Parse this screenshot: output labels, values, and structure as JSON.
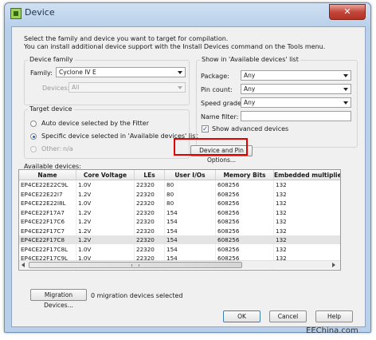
{
  "window": {
    "title": "Device",
    "close_symbol": "✕"
  },
  "intro": {
    "line1": "Select the family and device you want to target for compilation.",
    "line2": "You can install additional device support with the Install Devices command on the Tools menu."
  },
  "device_family": {
    "group_label": "Device family",
    "family_label": "Family:",
    "family_value": "Cyclone IV E",
    "devices_label": "Devices:",
    "devices_value": "All"
  },
  "target_device": {
    "group_label": "Target device",
    "option_auto": "Auto device selected by the Fitter",
    "option_specific": "Specific device selected in 'Available devices' list",
    "option_other": "Other:",
    "other_value": "n/a",
    "selected": "specific"
  },
  "show_in_list": {
    "group_label": "Show in 'Available devices' list",
    "package_label": "Package:",
    "package_value": "Any",
    "pin_count_label": "Pin count:",
    "pin_count_value": "Any",
    "speed_grade_label": "Speed grade:",
    "speed_grade_value": "Any",
    "name_filter_label": "Name filter:",
    "name_filter_value": "",
    "show_advanced_label": "Show advanced devices",
    "show_advanced_checked": true
  },
  "device_pin_options_label": "Device and Pin Options...",
  "available_devices": {
    "label": "Available devices:",
    "columns": [
      "Name",
      "Core Voltage",
      "LEs",
      "User I/Os",
      "Memory Bits",
      "Embedded multiplie"
    ],
    "rows": [
      [
        "EP4CE22E22C9L",
        "1.0V",
        "22320",
        "80",
        "608256",
        "132"
      ],
      [
        "EP4CE22E22I7",
        "1.2V",
        "22320",
        "80",
        "608256",
        "132"
      ],
      [
        "EP4CE22E22I8L",
        "1.0V",
        "22320",
        "80",
        "608256",
        "132"
      ],
      [
        "EP4CE22F17A7",
        "1.2V",
        "22320",
        "154",
        "608256",
        "132"
      ],
      [
        "EP4CE22F17C6",
        "1.2V",
        "22320",
        "154",
        "608256",
        "132"
      ],
      [
        "EP4CE22F17C7",
        "1.2V",
        "22320",
        "154",
        "608256",
        "132"
      ],
      [
        "EP4CE22F17C8",
        "1.2V",
        "22320",
        "154",
        "608256",
        "132"
      ],
      [
        "EP4CE22F17C8L",
        "1.0V",
        "22320",
        "154",
        "608256",
        "132"
      ],
      [
        "EP4CE22F17C9L",
        "1.0V",
        "22320",
        "154",
        "608256",
        "132"
      ]
    ],
    "selected_row": 6
  },
  "migration": {
    "button_label": "Migration Devices...",
    "status_text": "0 migration devices selected"
  },
  "footer": {
    "ok": "OK",
    "cancel": "Cancel",
    "help": "Help"
  },
  "watermark": "EEChina.com",
  "colors": {
    "highlight": "#e00000",
    "title_bar": "#b9d0ea",
    "close_button": "#c3463a"
  }
}
